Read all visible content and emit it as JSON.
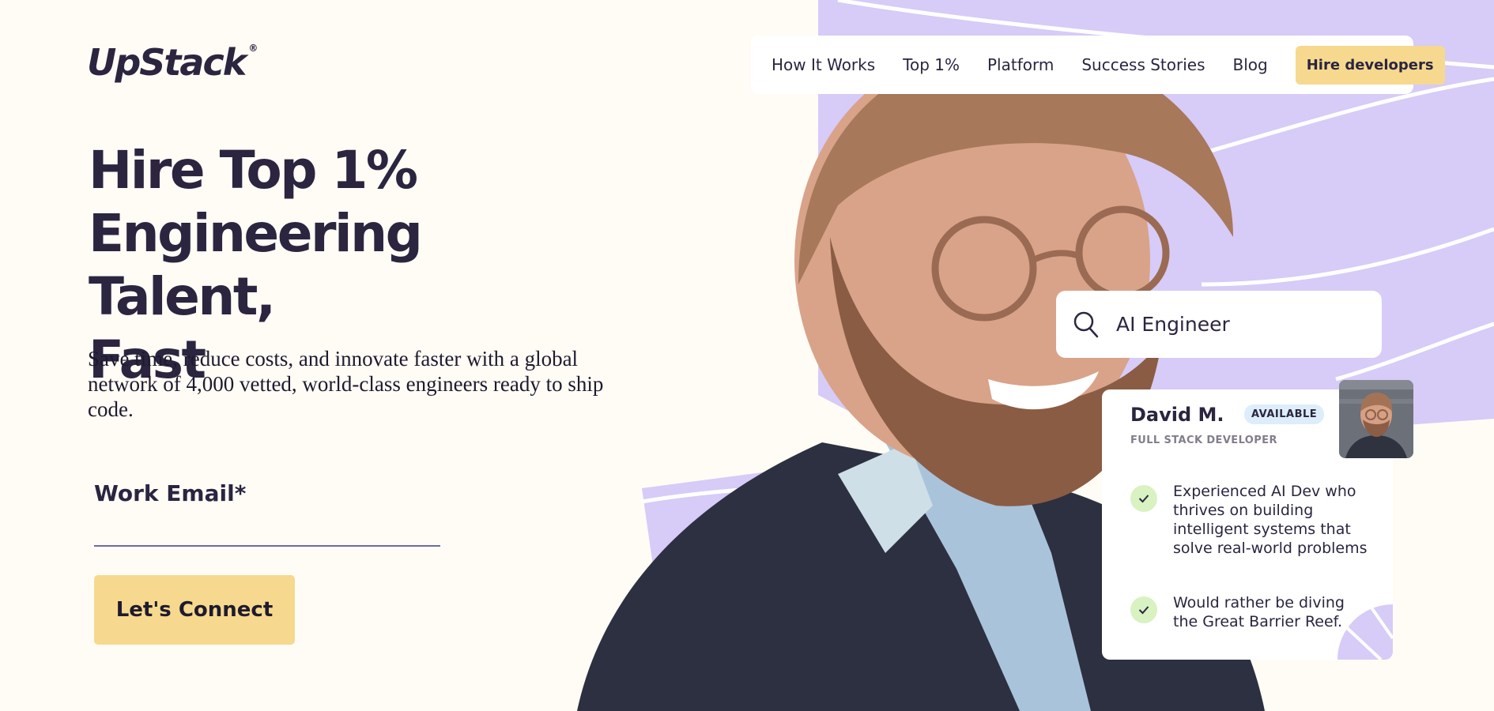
{
  "brand": {
    "name": "UpStack",
    "mark": "®"
  },
  "nav": {
    "items": [
      {
        "label": "How It Works"
      },
      {
        "label": "Top 1%"
      },
      {
        "label": "Platform"
      },
      {
        "label": "Success Stories"
      },
      {
        "label": "Blog"
      }
    ],
    "cta_label": "Hire developers"
  },
  "hero": {
    "title_lines": [
      "Hire Top 1%",
      "Engineering Talent,",
      "Fast"
    ],
    "subtitle": "Save time, reduce costs, and innovate faster with a global network of 4,000 vetted, world-class engineers ready to ship code."
  },
  "form": {
    "email_label": "Work Email*",
    "email_value": "",
    "submit_label": "Let's Connect"
  },
  "search": {
    "query": "AI Engineer",
    "icon": "search-icon"
  },
  "profile": {
    "name": "David M.",
    "status": "AVAILABLE",
    "role": "FULL STACK DEVELOPER",
    "facts": [
      {
        "text": "Experienced AI Dev who thrives on building intelligent systems that solve real-world problems"
      },
      {
        "text": "Would rather be diving the Great Barrier Reef."
      }
    ]
  },
  "colors": {
    "background": "#fefcf5",
    "text": "#2b2540",
    "accent_yellow": "#f6d98e",
    "lavender": "#d7cbf7",
    "badge_blue": "#ddeefa",
    "check_green": "#d8f2c2"
  }
}
